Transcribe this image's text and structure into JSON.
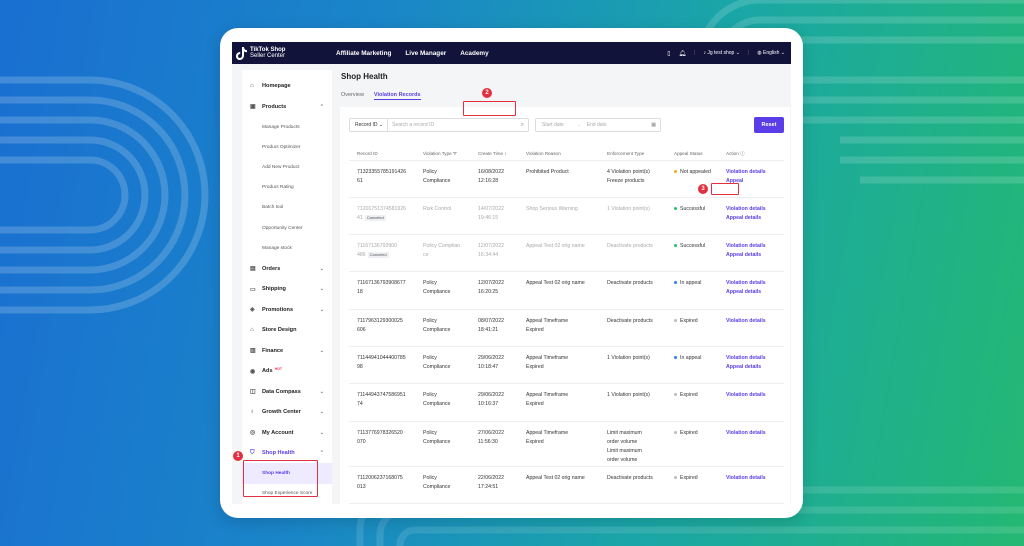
{
  "colors": {
    "accent": "#5b3de8",
    "topbar": "#12133a",
    "highlight": "#e23040",
    "success": "#27c26c",
    "warning": "#f5a623",
    "info": "#2f7cf6",
    "neutral": "#bbbbbb"
  },
  "brand": {
    "line1": "TikTok Shop",
    "line2": "Seller Center",
    "icon": "tiktok-logo-icon"
  },
  "topnav": {
    "items": [
      "Affiliate Marketing",
      "Live Manager",
      "Academy"
    ]
  },
  "topbar_right": {
    "shop_name": "Jg test shop",
    "language": "English",
    "icons": [
      "phone-icon",
      "bell-icon",
      "shop-avatar-icon",
      "globe-icon"
    ]
  },
  "sidebar": {
    "items": [
      {
        "label": "Homepage",
        "icon": "home-icon",
        "chevron": "",
        "hot": ""
      },
      {
        "label": "Products",
        "icon": "product-icon",
        "chevron": "⌃",
        "hot": ""
      }
    ],
    "product_subitems": [
      "Manage Products",
      "Product Optimizer",
      "Add New Product",
      "Product Rating",
      "Batch tool",
      "Opportunity Center",
      "Manage stock"
    ],
    "items2": [
      {
        "label": "Orders",
        "icon": "orders-icon",
        "chevron": "⌄",
        "hot": ""
      },
      {
        "label": "Shipping",
        "icon": "shipping-icon",
        "chevron": "⌄",
        "hot": ""
      },
      {
        "label": "Promotions",
        "icon": "promotions-icon",
        "chevron": "⌄",
        "hot": ""
      },
      {
        "label": "Store Design",
        "icon": "store-icon",
        "chevron": "",
        "hot": ""
      },
      {
        "label": "Finance",
        "icon": "finance-icon",
        "chevron": "⌄",
        "hot": ""
      },
      {
        "label": "Ads",
        "icon": "ads-icon",
        "chevron": "",
        "hot": "HOT"
      },
      {
        "label": "Data Compass",
        "icon": "data-icon",
        "chevron": "⌄",
        "hot": ""
      },
      {
        "label": "Growth Center",
        "icon": "growth-icon",
        "chevron": "⌄",
        "hot": ""
      },
      {
        "label": "My Account",
        "icon": "account-icon",
        "chevron": "⌄",
        "hot": ""
      }
    ],
    "shop_health": {
      "label": "Shop Health",
      "icon": "shield-icon",
      "chevron": "⌃"
    },
    "health_subitems": [
      "Shop Health",
      "Shop Experience Score"
    ]
  },
  "page": {
    "title": "Shop Health",
    "tabs": [
      "Overview",
      "Violation Records"
    ],
    "filter": {
      "select_label": "Record ID",
      "search_placeholder": "Search a record ID",
      "start_placeholder": "Start date",
      "end_placeholder": "End date",
      "reset_label": "Reset"
    }
  },
  "table": {
    "headers": [
      "Record ID",
      "Violation Type",
      "Create Time",
      "Violation Reason",
      "Enforcement Type",
      "Appeal Status",
      "Action"
    ],
    "rows": [
      {
        "id1": "71323355785191426",
        "id2": "61",
        "cancel": "",
        "type1": "Policy",
        "type2": "Compliance",
        "date": "16/08/2022",
        "time": "12:16:28",
        "reason1": "Prohibited Product",
        "reason2": "",
        "enf1": "4 Violation point(s)",
        "enf2": "Freeze products",
        "enf3": "",
        "status": "Not appealed",
        "status_color": "#f5a623",
        "action1": "Violation details",
        "action2": "Appeal",
        "muted": false
      },
      {
        "id1": "71201751374581926",
        "id2": "41",
        "cancel": "Canceled",
        "type1": "Risk Control",
        "type2": "",
        "date": "14/07/2022",
        "time": "19:46:15",
        "reason1": "Shop Serious Warning",
        "reason2": "",
        "enf1": "1 Violation point(s)",
        "enf2": "",
        "enf3": "",
        "status": "Successful",
        "status_color": "#27c26c",
        "action1": "Violation details",
        "action2": "Appeal details",
        "muted": true
      },
      {
        "id1": "71167136793900",
        "id2": "486",
        "cancel": "Canceled",
        "type1": "Policy Complian",
        "type2": "ce",
        "date": "12/07/2022",
        "time": "16:34:44",
        "reason1": "Appeal Test 02 orig name",
        "reason2": "",
        "enf1": "Deactivate products",
        "enf2": "",
        "enf3": "",
        "status": "Successful",
        "status_color": "#27c26c",
        "action1": "Violation details",
        "action2": "Appeal details",
        "muted": true
      },
      {
        "id1": "71167136793908677",
        "id2": "18",
        "cancel": "",
        "type1": "Policy",
        "type2": "Compliance",
        "date": "12/07/2022",
        "time": "16:20:25",
        "reason1": "Appeal Test 02 orig name",
        "reason2": "",
        "enf1": "Deactivate products",
        "enf2": "",
        "enf3": "",
        "status": "In appeal",
        "status_color": "#2f7cf6",
        "action1": "Violation details",
        "action2": "Appeal details",
        "muted": false
      },
      {
        "id1": "7117963129300025",
        "id2": "606",
        "cancel": "",
        "type1": "Policy",
        "type2": "Compliance",
        "date": "08/07/2022",
        "time": "18:41:21",
        "reason1": "Appeal Timeframe",
        "reason2": "Expired",
        "enf1": "Deactivate products",
        "enf2": "",
        "enf3": "",
        "status": "Expired",
        "status_color": "#bbbbbb",
        "action1": "Violation details",
        "action2": "",
        "muted": false
      },
      {
        "id1": "71144941044400785",
        "id2": "98",
        "cancel": "",
        "type1": "Policy",
        "type2": "Compliance",
        "date": "29/06/2022",
        "time": "10:18:47",
        "reason1": "Appeal Timeframe",
        "reason2": "Expired",
        "enf1": "1 Violation point(s)",
        "enf2": "",
        "enf3": "",
        "status": "In appeal",
        "status_color": "#2f7cf6",
        "action1": "Violation details",
        "action2": "Appeal details",
        "muted": false
      },
      {
        "id1": "71144943747586951",
        "id2": "74",
        "cancel": "",
        "type1": "Policy",
        "type2": "Compliance",
        "date": "29/06/2022",
        "time": "10:16:37",
        "reason1": "Appeal Timeframe",
        "reason2": "Expired",
        "enf1": "1 Violation point(s)",
        "enf2": "",
        "enf3": "",
        "status": "Expired",
        "status_color": "#bbbbbb",
        "action1": "Violation details",
        "action2": "",
        "muted": false
      },
      {
        "id1": "7113776978326520",
        "id2": "070",
        "cancel": "",
        "type1": "Policy",
        "type2": "Compliance",
        "date": "27/06/2022",
        "time": "11:56:30",
        "reason1": "Appeal Timeframe",
        "reason2": "Expired",
        "enf1": "Limit maximum",
        "enf2": "order volume",
        "enf3": "Limit maximum order volume",
        "status": "Expired",
        "status_color": "#bbbbbb",
        "action1": "Violation details",
        "action2": "",
        "muted": false
      },
      {
        "id1": "7112006237168075",
        "id2": "013",
        "cancel": "",
        "type1": "Policy",
        "type2": "Compliance",
        "date": "22/06/2022",
        "time": "17:24:51",
        "reason1": "Appeal Test 02 orig name",
        "reason2": "",
        "enf1": "Deactivate products",
        "enf2": "",
        "enf3": "",
        "status": "Expired",
        "status_color": "#bbbbbb",
        "action1": "Violation details",
        "action2": "",
        "muted": false
      }
    ]
  },
  "callouts": [
    "1",
    "2",
    "3"
  ]
}
